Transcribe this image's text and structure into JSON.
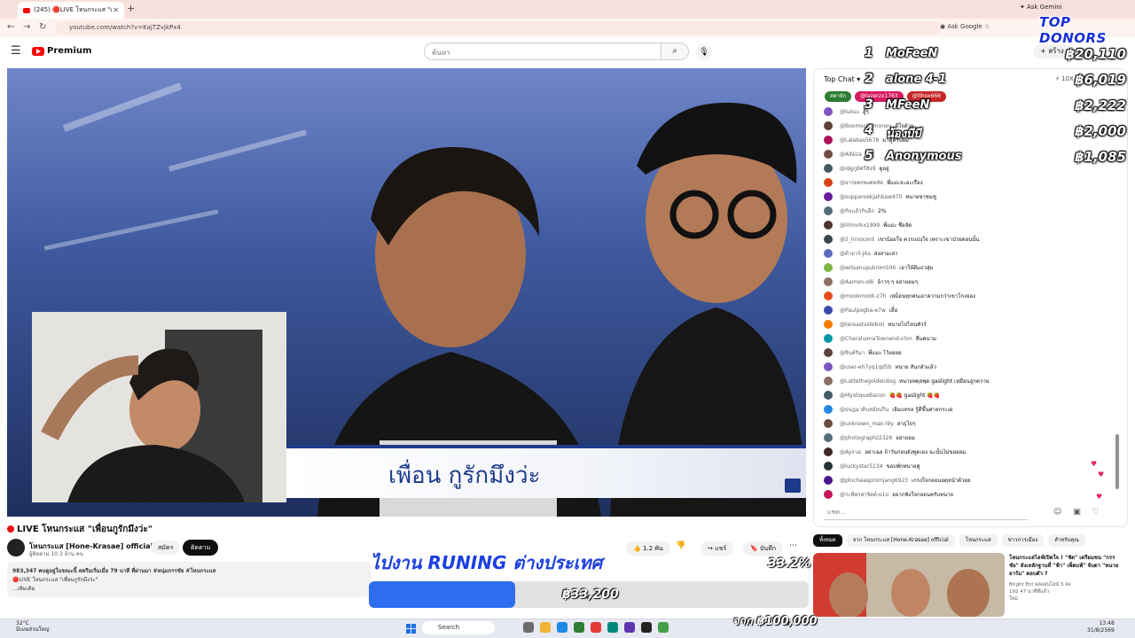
{
  "browser": {
    "tab_title": "(245) 🔴LIVE โหนกระแส \"เพื่อ...",
    "url": "youtube.com/watch?v=KajTZvjkPx4",
    "ask_gemini": "Ask Gemini",
    "ask_google": "Ask Google"
  },
  "youtube": {
    "logo_text": "Premium",
    "search_placeholder": "ค้นหา",
    "create_label": "สร้าง"
  },
  "video": {
    "lower_third_text": "เพื่อน กูรักมึงว่ะ",
    "title": "LIVE โหนกระแส \"เพื่อนกูรักมึงว่ะ\"",
    "channel_name": "โหนกระแส [Hone-Krasae] official",
    "subscribers": "ผู้ติดตาม 10.3 ล้าน คน",
    "join_label": "สมัคร",
    "subscribe_label": "ติดตาม",
    "like_count": "1.2 พัน",
    "share_label": "แชร์",
    "save_label": "บันทึก",
    "description_stats": "983,347 คนดูอยู่ในขณะนี้ สตรีมเริ่มเมื่อ 79 นาที ที่ผ่านมา #หนุ่มกรรชัย #โหนกระแส",
    "description_line2": "🔴LIVE โหนกระแส \"เพื่อนกูรักมึงว่ะ\"",
    "description_more": "...เพิ่มเติม"
  },
  "chat": {
    "header": "Top Chat",
    "xp_label": "10X",
    "pinned": [
      {
        "label": "สดาจัก",
        "color": "#2e7d32"
      },
      {
        "label": "@lazerzx1763",
        "color": "#d81b60"
      },
      {
        "label": "@lthox666",
        "color": "#c62828"
      }
    ],
    "messages": [
      {
        "author": "@luksu",
        "text": "สู้ๆ",
        "color": "#7e57c2"
      },
      {
        "author": "@Boomsolarmoney",
        "text": "ดีใจด้วย",
        "color": "#5d4037"
      },
      {
        "author": "@Lalabas5678",
        "text": "มาดูครับผม",
        "color": "#ad1457"
      },
      {
        "author": "@AiNiza",
        "text": "ไม่รู้",
        "color": "#6d4c41"
      },
      {
        "author": "@ณัฐภูมิศรีสังข์",
        "text": "ดูอยู่",
        "color": "#455a64"
      },
      {
        "author": "@อารยพรพงศคลัด",
        "text": "พี่แม่ะจะอะเรื่อง",
        "color": "#d84315"
      },
      {
        "author": "@supparoekjahbaw470",
        "text": "ทนายขาชมชู",
        "color": "#6a1b9a"
      },
      {
        "author": "@กิบแล้วกิบอีก",
        "text": "2%",
        "color": "#546e7a"
      },
      {
        "author": "@lilmvrkx1999",
        "text": "พี่แม่ะ ชื่อจัด",
        "color": "#4e342e"
      },
      {
        "author": "@2_Innocent",
        "text": "เขาน้อยใจ ควรแบ่งใจ เพราะเขาป่วยตอนนั้น",
        "color": "#37474f"
      },
      {
        "author": "@ต้าอาร์-j4a",
        "text": "ส่งสามเล่า",
        "color": "#5c6bc0"
      },
      {
        "author": "@witsanupuknim506",
        "text": "เอาให้ดีแถวสุ่ม",
        "color": "#7cb342"
      },
      {
        "author": "@Aamon-o9i",
        "text": "อ้าวๆ ๆ อย่ายอมๆ",
        "color": "#8d6e63"
      },
      {
        "author": "@mookmook-z7h",
        "text": "เหม็อนทุกคนเอาความกว่าเขาโกงจอง",
        "color": "#e64a19"
      },
      {
        "author": "@Paulpogba-e7w",
        "text": "เลิ้อ",
        "color": "#3949ab"
      },
      {
        "author": "@tereastsideboii",
        "text": "ทนายไปไหนทัวร์",
        "color": "#f57c00"
      },
      {
        "author": "@CharaluxnaTownend-v5m",
        "text": "ยืนคนาม",
        "color": "#0097a7"
      },
      {
        "author": "@จินค์ริมา",
        "text": "พี่แม่ะ ไว้ยอยย",
        "color": "#5d4037"
      },
      {
        "author": "@user-eh7yq1qd5b",
        "text": "ทนาย สันกลัวแล้ว",
        "color": "#7e57c2"
      },
      {
        "author": "@Lattethegoldendog",
        "text": "ทนายทดุลพุด gaslight เหมือนลูกความ",
        "color": "#8d6e63"
      },
      {
        "author": "@MystiqueBacon",
        "text": "🍓🍓 gaslight 🍓🍓",
        "color": "#455a64"
      },
      {
        "author": "@ธนฎฉาดิบสมัยปรีน",
        "text": "เอิมแทรอ รู้ดีขึ้นศาลกระเผ่",
        "color": "#1e88e5"
      },
      {
        "author": "@unknown_man-i9y",
        "text": "สาธุไปๆ",
        "color": "#6d4c41"
      },
      {
        "author": "@photographz2326",
        "text": "อย่ายอม",
        "color": "#546e7a"
      },
      {
        "author": "@Ayirus",
        "text": "อย่าเฉย ถ้าวันก่อนยังพูดเอง ฉะนั้นไม่ขอยอม",
        "color": "#3e2723"
      },
      {
        "author": "@luckystar5134",
        "text": "ขอบพักทนายคู่",
        "color": "#263238"
      },
      {
        "author": "@phicheasprornjang6923",
        "text": "เกรงใจกลอนอดุหน้าด้วยย",
        "color": "#4a148c"
      },
      {
        "author": "@ระพีพรสาจิตต์-ผ1ป",
        "text": "อยากฟังใจกลอนครับทนาย",
        "color": "#c2185b"
      }
    ],
    "input_placeholder": "แชท..."
  },
  "right_column": {
    "chips": [
      "ทั้งหมด",
      "จาก โหนกระแส [Hone-Krasae] official",
      "โหนกระแส",
      "ข่าวการเมือง",
      "สำหรับคุณ"
    ],
    "rec_title": "โหนกระแสไลฟ์เปิดใจ ! \"ชัด\" เตรียมชน \"กรรชัย\" ลังเหลักฐานที่ \"ฟ้า\" เพ็ดแพ้\" จับตา \"ทนายอาร์ม\" ตอบตัว ?",
    "rec_channel": "Bright Ent ผลออนไลน์ 3 ล่อ",
    "rec_views": "192 47 นาทีที่แล้ว",
    "rec_badge": "ใหม่"
  },
  "taskbar": {
    "weather_temp": "32°C",
    "weather_text": "มีเมฆส่วนใหญ่",
    "search_label": "Search",
    "time": "13:48",
    "date": "31/8/2569"
  },
  "overlay": {
    "top_donors_title": "TOP DONORS",
    "donors": [
      {
        "rank": "1",
        "name": "MoFeeN",
        "amount": "฿20,110"
      },
      {
        "rank": "2",
        "name": "alone 4-1",
        "amount": "฿6,019"
      },
      {
        "rank": "3",
        "name": "MFeeN",
        "amount": "฿2,222"
      },
      {
        "rank": "4",
        "name": "น้องบีบี",
        "amount": "฿2,000"
      },
      {
        "rank": "5",
        "name": "Anonymous",
        "amount": "฿1,085"
      }
    ],
    "goal_title": "ไปงาน RUNING ต่างประเทศ",
    "goal_percent": "33.2%",
    "goal_progress": 0.332,
    "goal_current": "฿33,200",
    "goal_target": "จาก ฿100,000"
  }
}
